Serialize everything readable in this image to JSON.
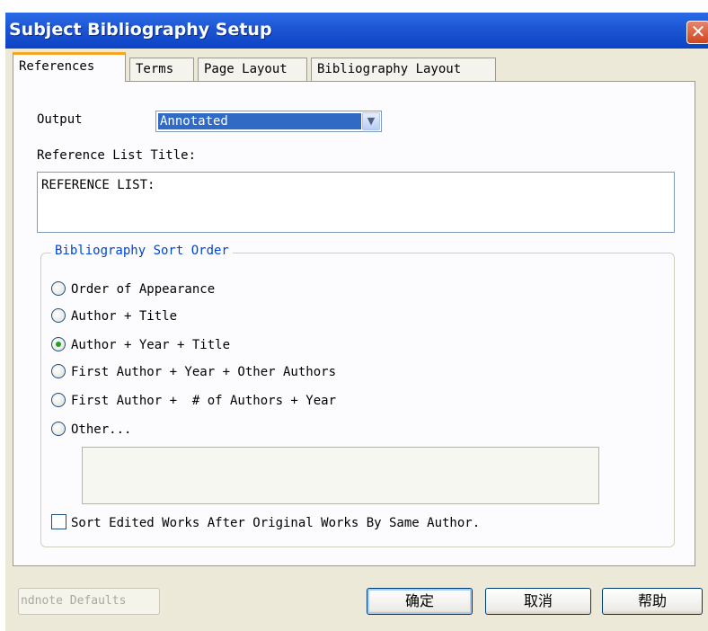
{
  "window": {
    "title": "Subject Bibliography Setup",
    "close_label": "✕"
  },
  "tabs": [
    {
      "label": "References",
      "active": true
    },
    {
      "label": "Terms",
      "active": false
    },
    {
      "label": "Page Layout",
      "active": false
    },
    {
      "label": "Bibliography Layout",
      "active": false
    }
  ],
  "output": {
    "label": "Output",
    "selected": "Annotated",
    "dropdown_icon": "chevron-down-icon"
  },
  "reference_list": {
    "label": "Reference List Title:",
    "value": "REFERENCE LIST:"
  },
  "sort_order": {
    "title": "Bibliography Sort Order",
    "options": [
      {
        "label": "Order of Appearance",
        "checked": false
      },
      {
        "label": "Author + Title",
        "checked": false
      },
      {
        "label": "Author + Year + Title",
        "checked": true
      },
      {
        "label": "First Author + Year + Other Authors",
        "checked": false
      },
      {
        "label": "First Author +  # of Authors + Year",
        "checked": false
      },
      {
        "label": "Other...",
        "checked": false
      }
    ],
    "other_value": "",
    "checkbox_label": "Sort Edited Works After Original Works By Same Author.",
    "checkbox_checked": false
  },
  "buttons": {
    "defaults": "ndnote Defaults",
    "ok": "确定",
    "cancel": "取消",
    "help": "帮助"
  },
  "colors": {
    "title_bar": "#0b43c5",
    "group_title": "#0046d5",
    "selection": "#316ac5",
    "active_tab_accent": "#f5a623",
    "radio_dot": "#21a121"
  }
}
